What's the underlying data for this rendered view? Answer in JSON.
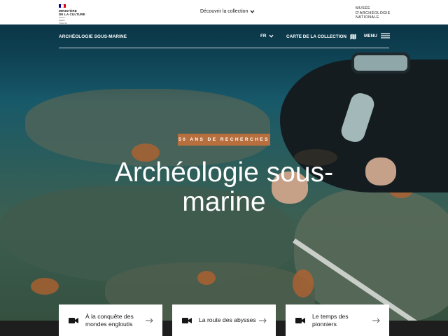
{
  "header": {
    "gov_logo_lines": [
      "MINISTÈRE",
      "DE LA CULTURE"
    ],
    "gov_logo_sub": [
      "Liberté",
      "Égalité",
      "Fraternité"
    ],
    "discover_label": "Découvrir la collection",
    "museum_logo_lines": [
      "MUSÉE",
      "D'ARCHÉOLOGIE",
      "NATIONALE"
    ]
  },
  "hero_nav": {
    "section_title": "ARCHÉOLOGIE SOUS-MARINE",
    "language": "FR",
    "collection_map_label": "CARTE DE LA COLLECTION",
    "menu_label": "MENU"
  },
  "hero": {
    "badge": "50 ANS DE RECHERCHES",
    "title": "Archéologie sous-marine"
  },
  "cards": [
    {
      "label": "À la conquête des mondes engloutis",
      "icon": "video-camera-icon"
    },
    {
      "label": "La route des abysses",
      "icon": "video-camera-icon"
    },
    {
      "label": "Le temps des pionniers",
      "icon": "video-camera-icon"
    }
  ],
  "colors": {
    "badge": "#b86f3e",
    "card_bg": "#ffffff",
    "text_dark": "#161616"
  }
}
